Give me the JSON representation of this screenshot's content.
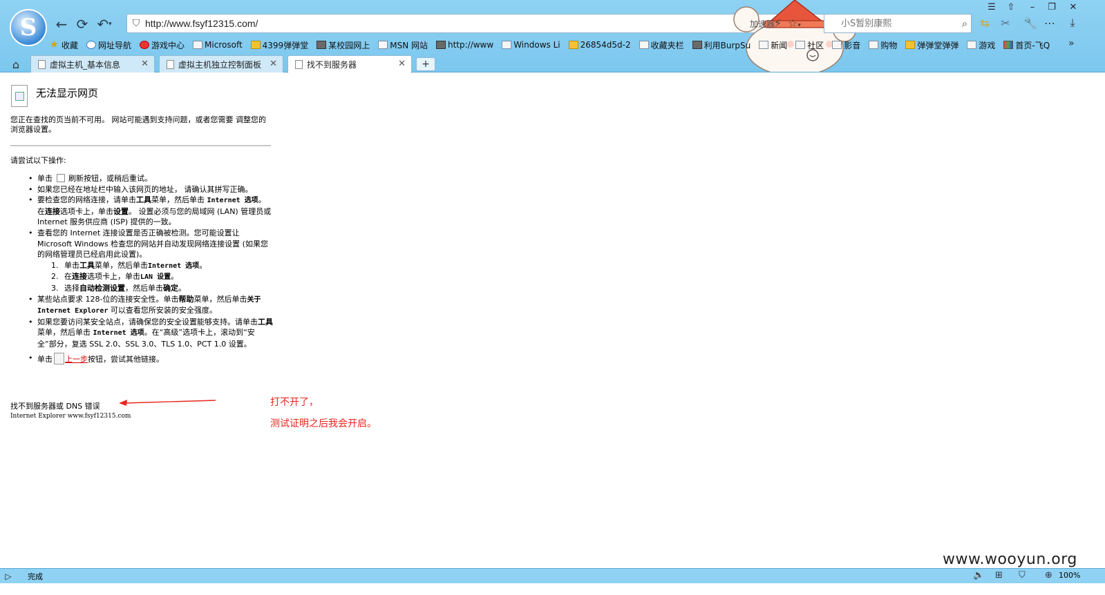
{
  "window": {
    "controls": [
      "☰",
      "⇧",
      "–",
      "❐",
      "✕"
    ]
  },
  "nav": {
    "address": "http://www.fsyf12315.com/",
    "accelerator_label": "加速器",
    "search_placeholder": "小S暂别康熙"
  },
  "bookmarks": [
    {
      "label": "收藏",
      "icon": "star-icon"
    },
    {
      "label": "网址导航",
      "icon": "globe-icon"
    },
    {
      "label": "游戏中心",
      "icon": "game-center-icon"
    },
    {
      "label": "Microsoft",
      "icon": "page-icon"
    },
    {
      "label": "4399弹弹堂",
      "icon": "4399-icon"
    },
    {
      "label": "某校园网上",
      "icon": "page-icon"
    },
    {
      "label": "MSN 网站",
      "icon": "page-icon"
    },
    {
      "label": "http://www",
      "icon": "image-icon"
    },
    {
      "label": "Windows Li",
      "icon": "page-icon"
    },
    {
      "label": "26854d5d-2",
      "icon": "gold-icon"
    },
    {
      "label": "收藏夹栏",
      "icon": "folder-icon"
    },
    {
      "label": "利用BurpSu",
      "icon": "page-icon"
    },
    {
      "label": "新闻",
      "icon": "folder-icon"
    },
    {
      "label": "社区",
      "icon": "folder-icon"
    },
    {
      "label": "影音",
      "icon": "folder-icon"
    },
    {
      "label": "购物",
      "icon": "folder-icon"
    },
    {
      "label": "弹弹堂弹弹",
      "icon": "ddt-icon"
    },
    {
      "label": "游戏",
      "icon": "folder-icon"
    },
    {
      "label": "首页-飞Q",
      "icon": "feiq-icon"
    }
  ],
  "bookmarks_more": "»",
  "tabs": [
    {
      "label": "虚拟主机_基本信息",
      "active": false
    },
    {
      "label": "虚拟主机独立控制面板",
      "active": false
    },
    {
      "label": "找不到服务器",
      "active": true
    }
  ],
  "tab_close": "✕",
  "new_tab": "+",
  "page": {
    "title": "无法显示网页",
    "desc": "您正在查找的页当前不可用。 网站可能遇到支持问题，或者您需要 调整您的浏览器设置。",
    "try_heading": "请尝试以下操作:",
    "tip1_pre": "单击",
    "tip1_post": "刷新按钮，或稍后重试。",
    "tip2": "如果您已经在地址栏中输入该网页的地址， 请确认其拼写正确。",
    "tip3_a": "要检查您的网络连接，请单击",
    "tip3_b": "工具",
    "tip3_c": "菜单，然后单击",
    "tip3_d": "Internet 选项",
    "tip3_e": "。在",
    "tip3_f": "连接",
    "tip3_g": "选项卡上，单击",
    "tip3_h": "设置",
    "tip3_i": "。 设置必须与您的局域网 (LAN) 管理员或 Internet 服务供应商 (ISP) 提供的一致。",
    "tip4": "查看您的 Internet 连接设置是否正确被检测。您可能设置让 Microsoft Windows 检查您的网站并自动发现网络连接设置 (如果您的网络管理员已经启用此设置)。",
    "tip4_steps": [
      {
        "num": "1.",
        "a": "单击",
        "b": "工具",
        "c": "菜单，然后单击",
        "d": "Internet 选项",
        "e": "。"
      },
      {
        "num": "2.",
        "a": "在",
        "b": "连接",
        "c": "选项卡上，单击",
        "d": "LAN 设置",
        "e": "。"
      },
      {
        "num": "3.",
        "a": "选择",
        "b": "自动检测设置",
        "c": "，然后单击",
        "d": "确定",
        "e": "。"
      }
    ],
    "tip5_a": "某些站点要求 128-位的连接安全性。单击",
    "tip5_b": "帮助",
    "tip5_c": "菜单，然后单击",
    "tip5_d": "关于 Internet Explorer",
    "tip5_e": " 可以查看您所安装的安全强度。",
    "tip6_a": "如果您要访问某安全站点，请确保您的安全设置能够支持。请单击",
    "tip6_b": "工具",
    "tip6_c": "菜单，然后单击",
    "tip6_d": "Internet 选项",
    "tip6_e": "。在“高级”选项卡上，滚动到“安全”部分，复选 SSL 2.0、SSL 3.0、TLS 1.0、PCT 1.0 设置。",
    "tip7_pre": "单击",
    "tip7_link": "上一步",
    "tip7_post": "按钮，尝试其他链接。",
    "footer": "找不到服务器或 DNS 错误",
    "footer_sub": "Internet Explorer www.fsyf12315.com"
  },
  "annotation": {
    "line1": "打不开了，",
    "line2": "测试证明之后我会开启。",
    "color": "#e8261d"
  },
  "watermark": "www.wooyun.org",
  "status": {
    "text": "完成",
    "zoom": "100%"
  }
}
